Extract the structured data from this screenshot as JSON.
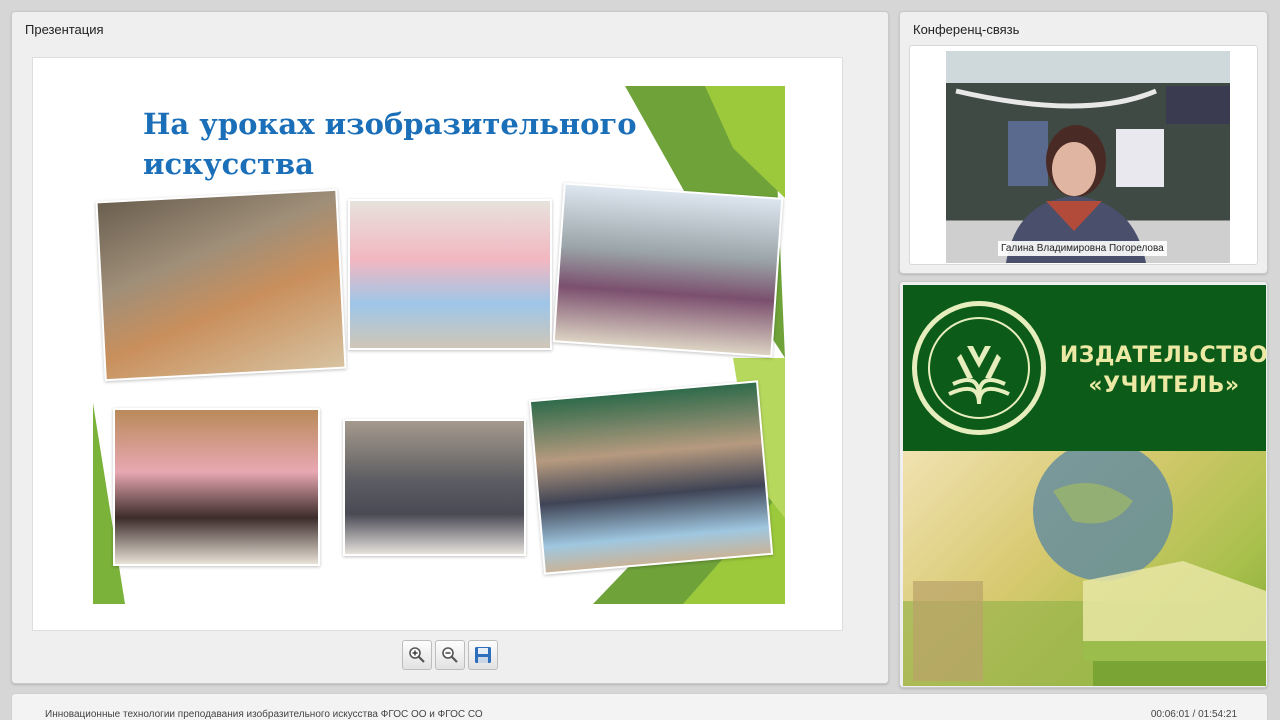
{
  "presentation": {
    "title": "Презентация",
    "slide": {
      "title": "На уроках изобразительного искусства"
    },
    "toolbar": {
      "zoom_in_icon": "zoom-in-icon",
      "zoom_out_icon": "zoom-out-icon",
      "save_icon": "save-icon"
    }
  },
  "conference": {
    "title": "Конференц-связь",
    "speaker_name": "Галина Владимировна Погорелова"
  },
  "publisher": {
    "line1": "ИЗДАТЕЛЬСТВО",
    "line2": "«УЧИТЕЛЬ»",
    "brand_color": "#0d5b19"
  },
  "footer": {
    "course_title": "Инновационные технологии преподавания изобразительного искусства ФГОС ОО и ФГОС СО",
    "time": "00:06:01 / 01:54:21"
  }
}
